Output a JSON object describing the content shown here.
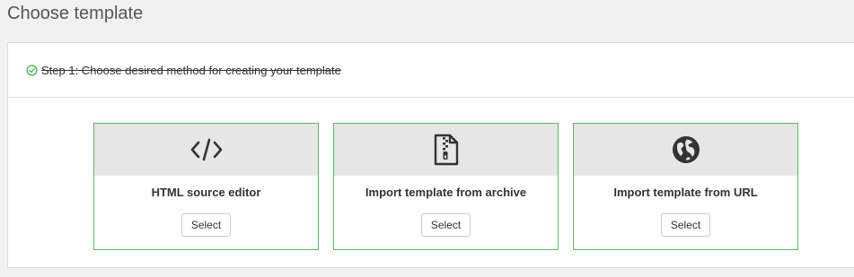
{
  "page": {
    "title": "Choose template"
  },
  "step": {
    "label": "Step 1: Choose desired method for creating your template",
    "status_color": "#5cb85c"
  },
  "cards": [
    {
      "icon": "code-icon",
      "title": "HTML source editor",
      "button_label": "Select"
    },
    {
      "icon": "zip-file-icon",
      "title": "Import template from archive",
      "button_label": "Select"
    },
    {
      "icon": "globe-icon",
      "title": "Import template from URL",
      "button_label": "Select"
    }
  ],
  "colors": {
    "card_border": "#5cb85c",
    "card_header_bg": "#e6e6e6",
    "icon": "#333333"
  }
}
